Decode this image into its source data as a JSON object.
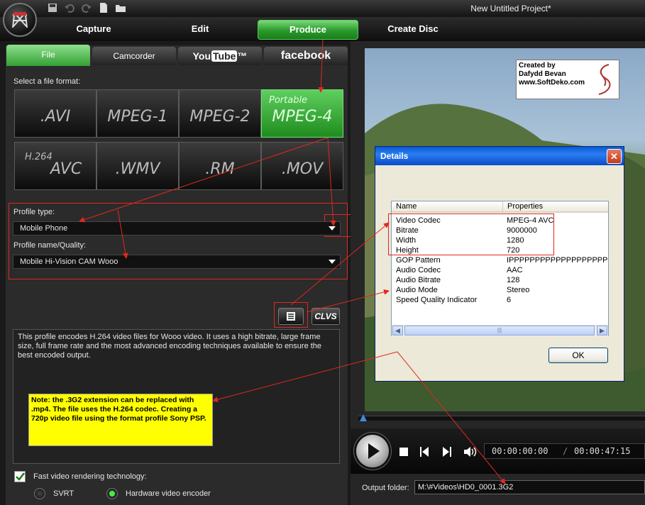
{
  "window": {
    "title": "New Untitled Project*"
  },
  "main_tabs": [
    {
      "label": "Capture"
    },
    {
      "label": "Edit"
    },
    {
      "label": "Produce"
    },
    {
      "label": "Create Disc"
    }
  ],
  "sub_tabs": {
    "file": "File",
    "camcorder": "Camcorder",
    "youtube_a": "You",
    "youtube_b": "Tube",
    "youtube_tm": "™",
    "facebook": "facebook"
  },
  "format_section": {
    "label": "Select a file format:",
    "formats": [
      {
        "prefix": "",
        "label": ".AVI"
      },
      {
        "prefix": "",
        "label": "MPEG-1"
      },
      {
        "prefix": "",
        "label": "MPEG-2"
      },
      {
        "prefix": "Portable",
        "label": "MPEG-4"
      },
      {
        "prefix": "H.264",
        "label": "AVC"
      },
      {
        "prefix": "",
        "label": ".WMV"
      },
      {
        "prefix": "",
        "label": ".RM"
      },
      {
        "prefix": "",
        "label": ".MOV"
      }
    ],
    "selected": "MPEG-4"
  },
  "profile": {
    "type_label": "Profile type:",
    "type_value": "Mobile Phone",
    "quality_label": "Profile name/Quality:",
    "quality_value": "Mobile Hi-Vision CAM Wooo"
  },
  "buttons": {
    "clvs": "CLVS"
  },
  "description": "This profile encodes H.264 video files for Wooo video. It uses a high bitrate, large frame size, full frame rate and the most advanced encoding techniques available to ensure the best encoded output.",
  "note": "Note: the .3G2 extension can be replaced with .mp4. The file uses the H.264 codec. Creating a 720p video file using the format profile Sony PSP.",
  "options": {
    "fast_render_label": "Fast video rendering technology:",
    "fast_render_checked": true,
    "svrt_label": "SVRT",
    "hw_label": "Hardware video encoder",
    "selected": "Hardware video encoder"
  },
  "watermark": {
    "line1": "Created by",
    "line2": "Dafydd Bevan",
    "line3": "www.SoftDeko.com"
  },
  "player": {
    "current_time": "00:00:00:00",
    "separator": "/",
    "total_time": "00:00:47:15",
    "seek_position": 0
  },
  "output": {
    "label": "Output folder:",
    "path": "M:\\#Videos\\HD0_0001.3G2"
  },
  "details_dialog": {
    "title": "Details",
    "close": "✕",
    "columns": [
      "Name",
      "Properties"
    ],
    "rows": [
      {
        "name": "Video Codec",
        "value": "MPEG-4 AVC"
      },
      {
        "name": "Bitrate",
        "value": "9000000"
      },
      {
        "name": "Width",
        "value": "1280"
      },
      {
        "name": "Height",
        "value": "720"
      },
      {
        "name": "GOP Pattern",
        "value": "IPPPPPPPPPPPPPPPPPPPPP..."
      },
      {
        "name": "Audio Codec",
        "value": "AAC"
      },
      {
        "name": "Audio Bitrate",
        "value": "128"
      },
      {
        "name": "Audio Mode",
        "value": "Stereo"
      },
      {
        "name": "Speed Quality Indicator",
        "value": "6"
      }
    ],
    "scroll_thumb": "|||",
    "ok": "OK"
  },
  "colors": {
    "accent_green": "#2a9a2a",
    "annotation_red": "#e0281e",
    "note_yellow": "#ffff00",
    "xp_blue": "#0a5ad8"
  }
}
